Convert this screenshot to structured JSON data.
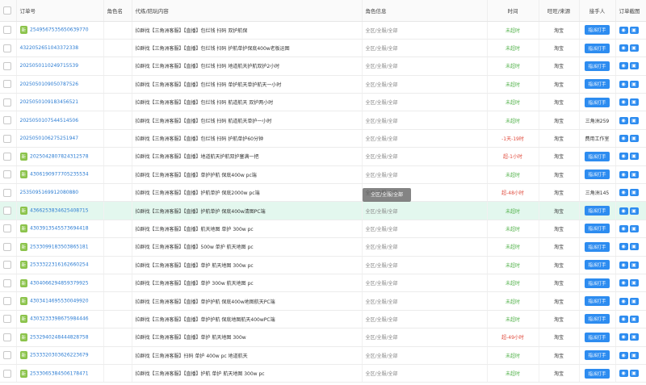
{
  "headers": [
    "订单号",
    "角色名",
    "代练/陪玩内容",
    "角色信息",
    "时间",
    "旺旺/来源",
    "接手人",
    "订单截图"
  ],
  "rows": [
    {
      "id": "2549567535650639770",
      "content": "拉群找【三角洲客服】【直播】包烂钱 扫码 双护航保",
      "region": "全区/全服/全部",
      "time": "未超时",
      "time_status": "green",
      "source": "淘宝",
      "taker": "",
      "has_button": true,
      "tag": "新"
    },
    {
      "id": "4322052651043372338",
      "content": "拉群找【三角洲客服】【直播】包烂钱 扫码 护航单护保底400w老板运图",
      "region": "全区/全服/全部",
      "time": "未超时",
      "time_status": "green",
      "source": "淘宝",
      "taker": "",
      "has_button": true,
      "tag": ""
    },
    {
      "id": "2025050110249715539",
      "content": "拉群找【三角洲客服】【直播】包烂钱 扫码 地道航天护航双护2小时",
      "region": "全区/全服/全部",
      "time": "未超时",
      "time_status": "green",
      "source": "淘宝",
      "taker": "",
      "has_button": true,
      "tag": ""
    },
    {
      "id": "2025050109050787526",
      "content": "拉群找【三角洲客服】【直播】包烂钱 扫码 单护航天单护航天一小时",
      "region": "全区/全服/全部",
      "time": "未超时",
      "time_status": "green",
      "source": "淘宝",
      "taker": "",
      "has_button": true,
      "tag": ""
    },
    {
      "id": "2025050109183456521",
      "content": "拉群找【三角洲客服】【直播】包烂钱 扫码 航道航天 双护两小时",
      "region": "全区/全服/全部",
      "time": "未超时",
      "time_status": "green",
      "source": "淘宝",
      "taker": "",
      "has_button": true,
      "tag": ""
    },
    {
      "id": "2025050107544514506",
      "content": "拉群找【三角洲客服】【直播】包烂钱 扫码 航道航天单护一小时",
      "region": "全区/全服/全部",
      "time": "未超时",
      "time_status": "green",
      "source": "淘宝",
      "taker": "三角洲259",
      "has_button": false,
      "tag": ""
    },
    {
      "id": "2025050106275251947",
      "content": "拉群找【三角洲客服】【直播】包烂钱 扫码 护航单护60分钟",
      "region": "全区/全服/全部",
      "time": "-1天-19时",
      "time_status": "red",
      "source": "淘宝",
      "taker": "费用工作室",
      "has_button": false,
      "tag": ""
    },
    {
      "id": "2025042807824312578",
      "content": "拉群找【三角洲客服】【直播】地道航天护航双护塞满一把",
      "region": "全区/全服/全部",
      "time": "超-1小时",
      "time_status": "red",
      "source": "淘宝",
      "taker": "",
      "has_button": true,
      "tag": "新"
    },
    {
      "id": "4306190977705235534",
      "content": "拉群找【三角洲客服】【直播】单护护航 保底400w pc端",
      "region": "全区/全服/全部",
      "time": "未超时",
      "time_status": "green",
      "source": "淘宝",
      "taker": "",
      "has_button": true,
      "tag": "新"
    },
    {
      "id": "2535095169912080880",
      "content": "拉群找【三角洲客服】【直播】护航单护 保底2000w pc端",
      "region": "全区/全服/全部",
      "time": "超-48小时",
      "time_status": "red",
      "source": "淘宝",
      "taker": "三角洲145",
      "has_button": false,
      "tag": ""
    },
    {
      "id": "4366253834625408715",
      "content": "拉群找【三角洲客服】【直播】护航单护 保底400w清图PC端",
      "region": "全区/全服/全部",
      "time": "未超时",
      "time_status": "green",
      "source": "淘宝",
      "taker": "",
      "has_button": true,
      "tag": "新",
      "highlight": true
    },
    {
      "id": "4303913545573694418",
      "content": "拉群找【三角洲客服】【直播】航天地图 单护 300w pc",
      "region": "全区/全服/全部",
      "time": "未超时",
      "time_status": "green",
      "source": "淘宝",
      "taker": "",
      "has_button": true,
      "tag": "新"
    },
    {
      "id": "2533099183503865181",
      "content": "拉群找【三角洲客服】【直播】500w 单护 航天地图 pc",
      "region": "全区/全服/全部",
      "time": "未超时",
      "time_status": "green",
      "source": "淘宝",
      "taker": "",
      "has_button": true,
      "tag": "新"
    },
    {
      "id": "2533322316162660254",
      "content": "拉群找【三角洲客服】【直播】单护 航天地图 300w pc",
      "region": "全区/全服/全部",
      "time": "未超时",
      "time_status": "green",
      "source": "淘宝",
      "taker": "",
      "has_button": true,
      "tag": "新"
    },
    {
      "id": "4304066294859379925",
      "content": "拉群找【三角洲客服】【直播】单护 300w 航天地图 pc",
      "region": "全区/全服/全部",
      "time": "未超时",
      "time_status": "green",
      "source": "淘宝",
      "taker": "",
      "has_button": true,
      "tag": "新"
    },
    {
      "id": "4303414695530049920",
      "content": "拉群找【三角洲客服】【直播】单护护航 保底400w地图航天PC端",
      "region": "全区/全服/全部",
      "time": "未超时",
      "time_status": "green",
      "source": "淘宝",
      "taker": "",
      "has_button": true,
      "tag": "新"
    },
    {
      "id": "4303233398675984446",
      "content": "拉群找【三角洲客服】【直播】单护护航 保底地图航天400wPC端",
      "region": "全区/全服/全部",
      "time": "未超时",
      "time_status": "green",
      "source": "淘宝",
      "taker": "",
      "has_button": true,
      "tag": "新"
    },
    {
      "id": "2532940248444828758",
      "content": "拉群找【三角洲客服】【直播】单护 航天地图 300w",
      "region": "全区/全服/全部",
      "time": "超-49小时",
      "time_status": "red",
      "source": "淘宝",
      "taker": "",
      "has_button": true,
      "tag": "新"
    },
    {
      "id": "2533320303626223679",
      "content": "拉群找【三角洲客服】扫码 单护 400w pc 地道航天",
      "region": "全区/全服/全部",
      "time": "未超时",
      "time_status": "green",
      "source": "淘宝",
      "taker": "",
      "has_button": true,
      "tag": "新"
    },
    {
      "id": "2533065384506178471",
      "content": "拉群找【三角洲客服】【直播】护航 单护 航天地图 300w pc",
      "region": "全区/全服/全部",
      "time": "未超时",
      "time_status": "green",
      "source": "淘宝",
      "taker": "",
      "has_button": true,
      "tag": "新"
    }
  ],
  "button_label": "指派打手",
  "tooltip": "全区/全服/全部",
  "colors": {
    "accent": "#2d8cf0",
    "tag": "#8bc34a",
    "ok": "#52b24a",
    "late": "#e04b3d",
    "highlight": "#e3f7ee"
  }
}
